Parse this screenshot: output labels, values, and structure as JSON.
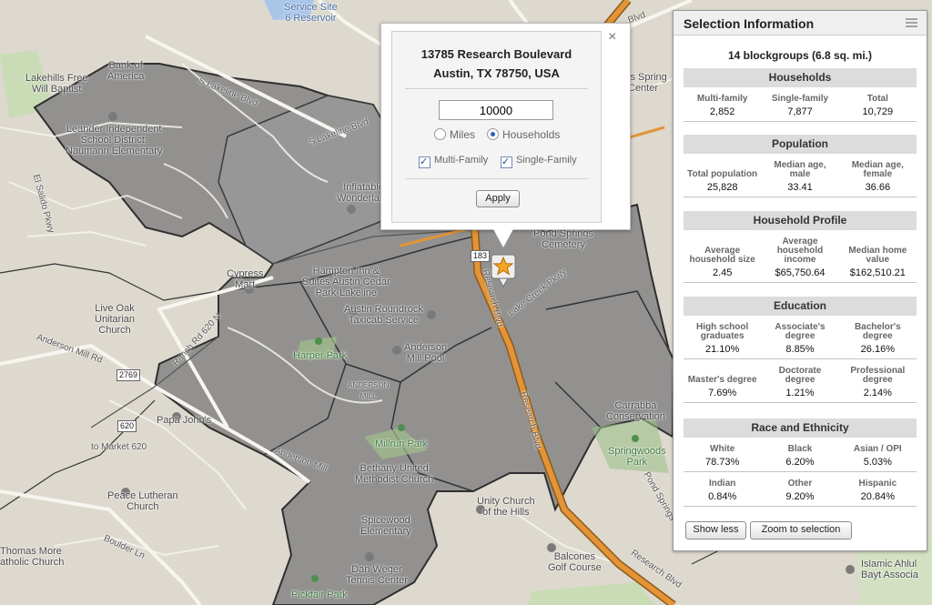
{
  "map": {
    "labels": [
      {
        "id": "service-site",
        "text": "Service Site\n6 Reservoir"
      },
      {
        "id": "lakehills",
        "text": "Lakehills Free\nWill Baptist"
      },
      {
        "id": "bank",
        "text": "Bank of\nAmerica"
      },
      {
        "id": "s-lakeline-1",
        "text": "S Lakeline Blvd"
      },
      {
        "id": "s-lakeline-2",
        "text": "S Lakeline Blvd"
      },
      {
        "id": "leander",
        "text": "Leander Independent\nSchool District:\nNaumann Elementary"
      },
      {
        "id": "el-salido",
        "text": "El Salido Pkwy"
      },
      {
        "id": "inflatable",
        "text": "Inflatable\nWonderland"
      },
      {
        "id": "cypress",
        "text": "Cypress\nMart"
      },
      {
        "id": "hampton",
        "text": "Hampton Inn &\nSuites Austin Cedar\nPark-Lakeline"
      },
      {
        "id": "live-oak",
        "text": "Live Oak\nUnitarian\nChurch"
      },
      {
        "id": "roundrock",
        "text": "Austin Roundrock\nTaxicab Service"
      },
      {
        "id": "harper",
        "text": "Harper Park"
      },
      {
        "id": "anderson-pool",
        "text": "Anderson\nMill Pool"
      },
      {
        "id": "anderson-mill",
        "text": "ANDERSON\nMILL"
      },
      {
        "id": "anderson-rd",
        "text": "Anderson Mill Rd"
      },
      {
        "id": "ranch-rd",
        "text": "Ranch Rd 620 N"
      },
      {
        "id": "papa",
        "text": "Papa John's"
      },
      {
        "id": "to-market",
        "text": "to Market 620"
      },
      {
        "id": "peace",
        "text": "Peace Lutheran\nChurch"
      },
      {
        "id": "boulder",
        "text": "Boulder Ln"
      },
      {
        "id": "thomas",
        "text": "Thomas More\natholic Church"
      },
      {
        "id": "millrun",
        "text": "Millrun Park"
      },
      {
        "id": "bethany",
        "text": "Bethany United\nMethodist Church"
      },
      {
        "id": "spicewood",
        "text": "Spicewood\nElementary"
      },
      {
        "id": "unity",
        "text": "Unity Church\nof the Hills"
      },
      {
        "id": "dan-weger",
        "text": "Dan Weger\nTennis Center"
      },
      {
        "id": "pickfair",
        "text": "Pickfair Park"
      },
      {
        "id": "balcones",
        "text": "Balcones\nGolf Course"
      },
      {
        "id": "research-1",
        "text": "Research Blvd"
      },
      {
        "id": "research-2",
        "text": "Research Blvd"
      },
      {
        "id": "research-3",
        "text": "Research Blvd"
      },
      {
        "id": "lake-creek",
        "text": "Lake Creek Pkwy"
      },
      {
        "id": "pond-springs",
        "text": "Pond Springs\nCemetery"
      },
      {
        "id": "carrabba",
        "text": "Carrabba\nConservation"
      },
      {
        "id": "springwoods",
        "text": "Springwoods\nPark"
      },
      {
        "id": "islamic",
        "text": "Islamic Ahlul\nBayt Associa"
      },
      {
        "id": "pond-springs-rd",
        "text": "Pond Springs"
      },
      {
        "id": "anderson-mill-2",
        "text": "Anderson Mill"
      },
      {
        "id": "spring-center",
        "text": "is Spring\nCenter"
      },
      {
        "id": "blvd",
        "text": "Blvd"
      }
    ],
    "shields": {
      "us183": "183",
      "rd2769": "2769",
      "rd620": "620"
    }
  },
  "popup": {
    "address_line1": "13785 Research Boulevard",
    "address_line2": "Austin, TX 78750, USA",
    "close_symbol": "×",
    "radius_value": "10000",
    "mode_miles": "Miles",
    "mode_households": "Households",
    "selected_mode": "Households",
    "multi_family": "Multi-Family",
    "single_family": "Single-Family",
    "apply": "Apply"
  },
  "panel": {
    "title": "Selection Information",
    "summary": "14 blockgroups (6.8 sq. mi.)",
    "households": {
      "title": "Households",
      "headers": [
        "Multi-family",
        "Single-family",
        "Total"
      ],
      "values": [
        "2,852",
        "7,877",
        "10,729"
      ]
    },
    "population": {
      "title": "Population",
      "headers": [
        "Total population",
        "Median age, male",
        "Median age, female"
      ],
      "values": [
        "25,828",
        "33.41",
        "36.66"
      ]
    },
    "household_profile": {
      "title": "Household Profile",
      "headers": [
        "Average household size",
        "Average household income",
        "Median home value"
      ],
      "values": [
        "2.45",
        "$65,750.64",
        "$162,510.21"
      ]
    },
    "education": {
      "title": "Education",
      "headers1": [
        "High school graduates",
        "Associate's degree",
        "Bachelor's degree"
      ],
      "values1": [
        "21.10%",
        "8.85%",
        "26.16%"
      ],
      "headers2": [
        "Master's degree",
        "Doctorate degree",
        "Professional degree"
      ],
      "values2": [
        "7.69%",
        "1.21%",
        "2.14%"
      ]
    },
    "race": {
      "title": "Race and Ethnicity",
      "headers1": [
        "White",
        "Black",
        "Asian / OPI"
      ],
      "values1": [
        "78.73%",
        "6.20%",
        "5.03%"
      ],
      "headers2": [
        "Indian",
        "Other",
        "Hispanic"
      ],
      "values2": [
        "0.84%",
        "9.20%",
        "20.84%"
      ]
    },
    "show_less": "Show less",
    "zoom_to_selection": "Zoom to selection"
  },
  "colors": {
    "selection_fill": "#8a8a8a",
    "highway": "#e08a2c",
    "park": "#9fc08a",
    "marker": "#f5a623"
  }
}
